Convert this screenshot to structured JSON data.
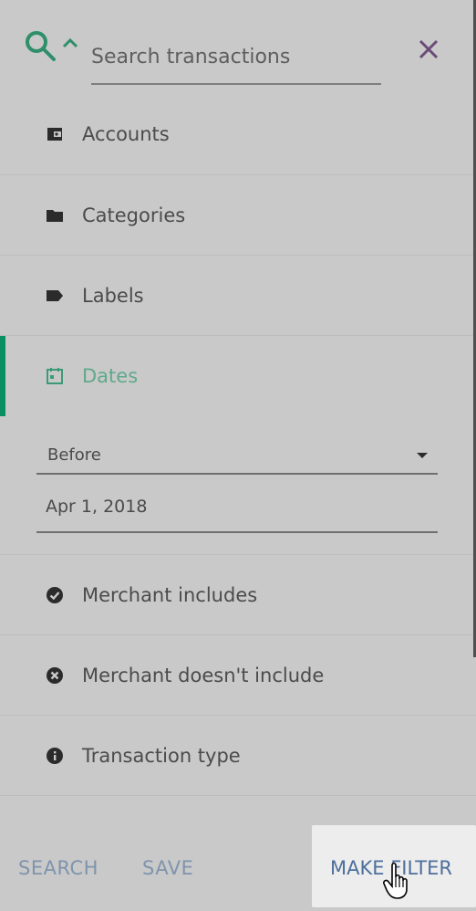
{
  "search": {
    "placeholder": "Search transactions",
    "value": ""
  },
  "menu": {
    "items": [
      {
        "label": "Accounts",
        "icon": "wallet-icon"
      },
      {
        "label": "Categories",
        "icon": "folder-icon"
      },
      {
        "label": "Labels",
        "icon": "tag-icon"
      },
      {
        "label": "Dates",
        "icon": "calendar-icon",
        "active": true
      },
      {
        "label": "Merchant includes",
        "icon": "check-circle-icon"
      },
      {
        "label": "Merchant doesn't include",
        "icon": "x-circle-icon"
      },
      {
        "label": "Transaction type",
        "icon": "info-circle-icon"
      }
    ]
  },
  "date_filter": {
    "mode": "Before",
    "date": "Apr 1, 2018"
  },
  "footer": {
    "search_label": "SEARCH",
    "save_label": "SAVE",
    "make_filter_label": "MAKE FILTER"
  },
  "colors": {
    "accent_green": "#0b8f62",
    "active_text": "#5fa98c",
    "close_purple": "#6b4a7a",
    "footer_blue": "#7f94ad"
  }
}
